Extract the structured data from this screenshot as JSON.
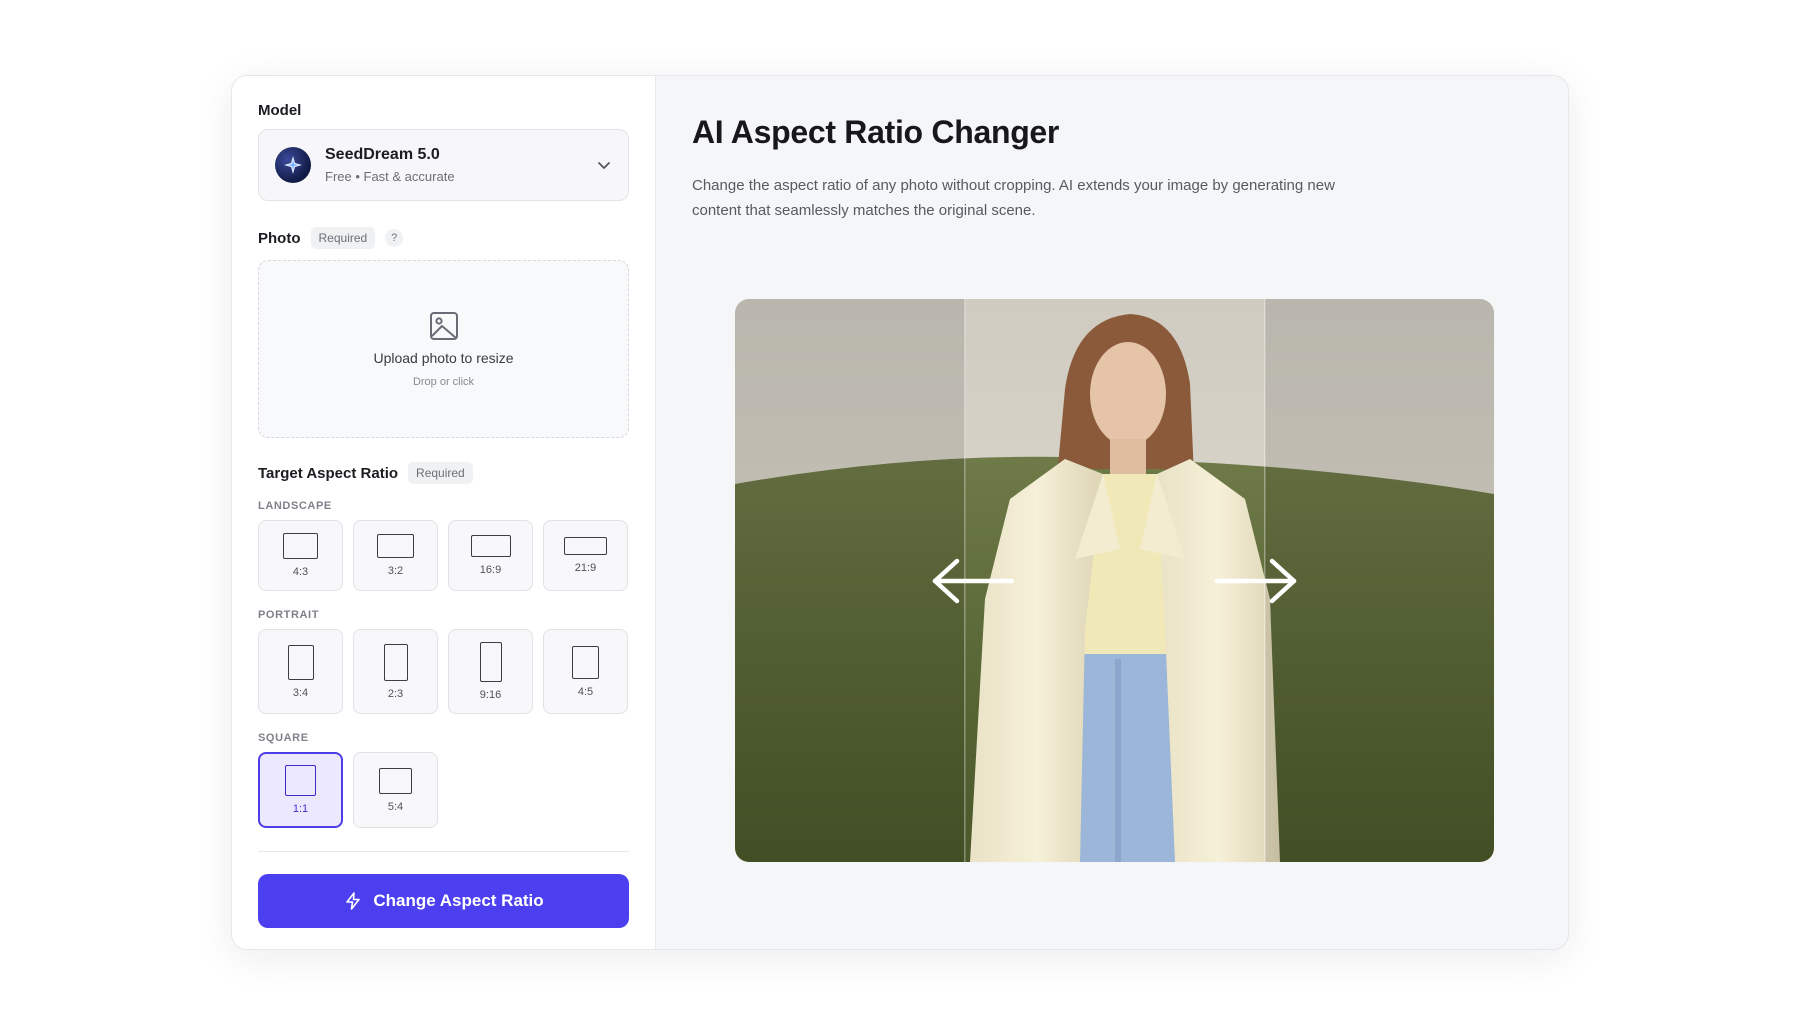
{
  "sidebar": {
    "model_label": "Model",
    "model": {
      "name": "SeedDream 5.0",
      "subtitle": "Free • Fast & accurate"
    },
    "photo": {
      "label": "Photo",
      "badge": "Required",
      "help": "?",
      "upload_title": "Upload photo to resize",
      "upload_sub": "Drop or click"
    },
    "target": {
      "label": "Target Aspect Ratio",
      "badge": "Required",
      "landscape_label": "LANDSCAPE",
      "landscape": [
        "4:3",
        "3:2",
        "16:9",
        "21:9"
      ],
      "portrait_label": "PORTRAIT",
      "portrait": [
        "3:4",
        "2:3",
        "9:16",
        "4:5"
      ],
      "square_label": "SQUARE",
      "square": [
        "1:1",
        "5:4"
      ],
      "selected": "1:1"
    },
    "cta_label": "Change Aspect Ratio"
  },
  "main": {
    "title": "AI Aspect Ratio Changer",
    "description": "Change the aspect ratio of any photo without cropping. AI extends your image by generating new content that seamlessly matches the original scene."
  },
  "colors": {
    "accent": "#4b3ff0",
    "selected_bg": "#ece9ff"
  }
}
